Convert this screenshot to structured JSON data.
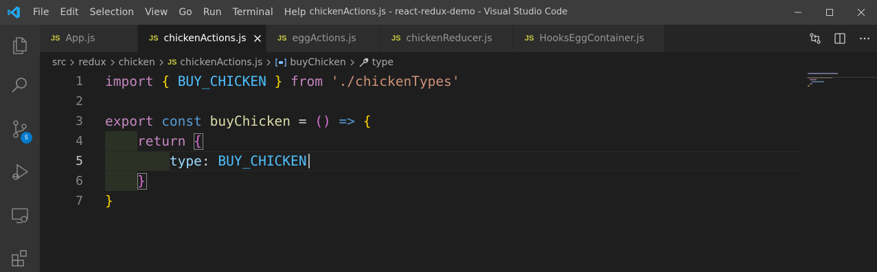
{
  "window": {
    "title": "chickenActions.js - react-redux-demo - Visual Studio Code",
    "menu": [
      "File",
      "Edit",
      "Selection",
      "View",
      "Go",
      "Run",
      "Terminal",
      "Help"
    ]
  },
  "activity_bar": {
    "items": [
      "explorer-icon",
      "search-icon",
      "source-control-icon",
      "run-debug-icon",
      "remote-explorer-icon",
      "extensions-icon"
    ],
    "source_control_badge": "5"
  },
  "tabs": [
    {
      "lang": "JS",
      "label": "App.js",
      "active": false
    },
    {
      "lang": "JS",
      "label": "chickenActions.js",
      "active": true
    },
    {
      "lang": "JS",
      "label": "eggActions.js",
      "active": false
    },
    {
      "lang": "JS",
      "label": "chickenReducer.js",
      "active": false
    },
    {
      "lang": "JS",
      "label": "HooksEggContainer.js",
      "active": false
    }
  ],
  "breadcrumbs": {
    "items": [
      "src",
      "redux",
      "chicken",
      "chickenActions.js",
      "buyChicken",
      "type"
    ],
    "file_lang": "JS"
  },
  "editor": {
    "line_numbers": [
      "1",
      "2",
      "3",
      "4",
      "5",
      "6",
      "7"
    ],
    "lines": [
      [
        {
          "t": "import",
          "c": "kw"
        },
        {
          "t": " ",
          "c": "op"
        },
        {
          "t": "{",
          "c": "br1"
        },
        {
          "t": " BUY_CHICKEN ",
          "c": "const"
        },
        {
          "t": "}",
          "c": "br1"
        },
        {
          "t": " from ",
          "c": "kw"
        },
        {
          "t": "'./chickenTypes'",
          "c": "str"
        }
      ],
      [],
      [
        {
          "t": "export",
          "c": "kw"
        },
        {
          "t": " const ",
          "c": "kw2"
        },
        {
          "t": "buyChicken",
          "c": "fn"
        },
        {
          "t": " = ",
          "c": "op"
        },
        {
          "t": "()",
          "c": "br2"
        },
        {
          "t": " => ",
          "c": "kw2"
        },
        {
          "t": "{",
          "c": "br1"
        }
      ],
      [
        {
          "t": "    ",
          "c": "op"
        },
        {
          "t": "return",
          "c": "kw"
        },
        {
          "t": " ",
          "c": "op"
        },
        {
          "t": "{",
          "c": "br2"
        }
      ],
      [
        {
          "t": "        ",
          "c": "op"
        },
        {
          "t": "type",
          "c": "prop"
        },
        {
          "t": ": ",
          "c": "op"
        },
        {
          "t": "BUY_CHICKEN",
          "c": "const"
        }
      ],
      [
        {
          "t": "    ",
          "c": "op"
        },
        {
          "t": "}",
          "c": "br2"
        }
      ],
      [
        {
          "t": "}",
          "c": "br1"
        }
      ]
    ],
    "current_line": "5"
  },
  "colors": {
    "accent": "#007acc",
    "js_badge": "#cbcb41",
    "editor_bg": "#1e1e1e",
    "titlebar_bg": "#3c3c3c"
  }
}
